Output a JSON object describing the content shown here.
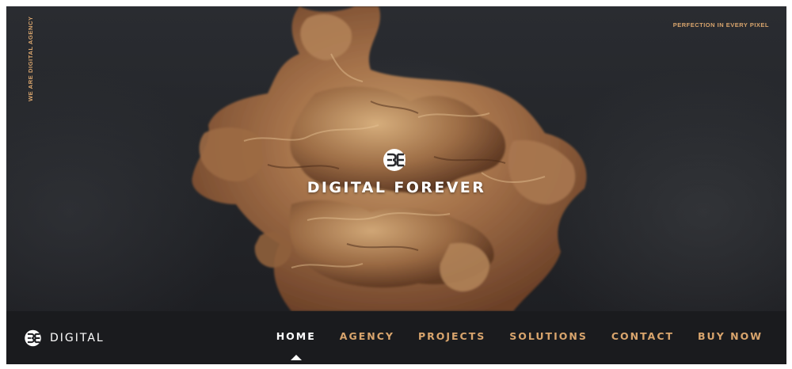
{
  "hero": {
    "side_text": "WE ARE DIGITAL AGENCY",
    "tagline": "PERFECTION IN EVERY PIXEL",
    "title": "DIGITAL FOREVER",
    "logo_icon": "be-logo-icon",
    "background_image": "abstract copper ink smoke on dark background"
  },
  "navbar": {
    "brand_name": "DIGITAL",
    "logo_icon": "be-logo-icon",
    "items": [
      {
        "label": "HOME",
        "active": true
      },
      {
        "label": "AGENCY",
        "active": false
      },
      {
        "label": "PROJECTS",
        "active": false
      },
      {
        "label": "SOLUTIONS",
        "active": false
      },
      {
        "label": "CONTACT",
        "active": false
      },
      {
        "label": "BUY NOW",
        "active": false
      }
    ]
  },
  "colors": {
    "accent": "#d9a56d",
    "background": "#1a1b1e",
    "text": "#ffffff"
  }
}
